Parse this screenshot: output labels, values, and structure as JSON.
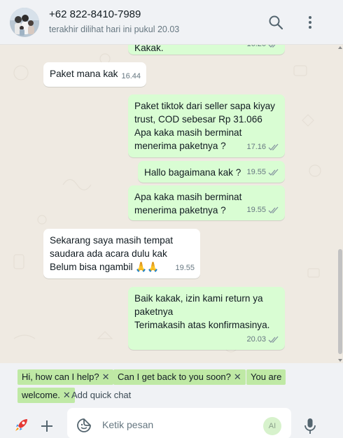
{
  "header": {
    "contact_name": "+62 822-8410-7989",
    "status": "terakhir dilihat hari ini pukul 20.03",
    "icons": [
      "search-icon",
      "more-vertical-icon"
    ]
  },
  "messages": [
    {
      "dir": "out",
      "text": "Kakak.",
      "time": "16.26",
      "ticks": "read"
    },
    {
      "dir": "in",
      "text": "Paket mana kak",
      "time": "16.44"
    },
    {
      "dir": "out",
      "text": "Paket tiktok dari seller sapa kiyay\ntrust, COD sebesar Rp 31.066\nApa kaka masih berminat\nmenerima paketnya ?",
      "time": "17.16",
      "ticks": "read"
    },
    {
      "dir": "out",
      "text": "Hallo bagaimana kak ?",
      "time": "19.55",
      "ticks": "read"
    },
    {
      "dir": "out",
      "text": "Apa kaka masih berminat\nmenerima paketnya ?",
      "time": "19.55",
      "ticks": "read"
    },
    {
      "dir": "in",
      "text": "Sekarang saya masih tempat\nsaudara ada acara dulu kak\nBelum bisa ngambil 🙏🙏",
      "time": "19.55"
    },
    {
      "dir": "out",
      "text": "Baik kakak, izin kami return ya\npaketnya\nTerimakasih atas konfirmasinya.",
      "time": "20.03",
      "ticks": "read"
    }
  ],
  "quick_chats": {
    "chips": [
      "Hi, how can I help?",
      "Can I get back to you soon?",
      "You are",
      "welcome."
    ],
    "add_label": "Add quick chat"
  },
  "composer": {
    "placeholder": "Ketik pesan",
    "ai_label": "AI"
  },
  "colors": {
    "outgoing_bubble": "#d9fdd3",
    "incoming_bubble": "#ffffff",
    "chip": "#bfe9a5",
    "read_ticks": "#8696a0"
  }
}
